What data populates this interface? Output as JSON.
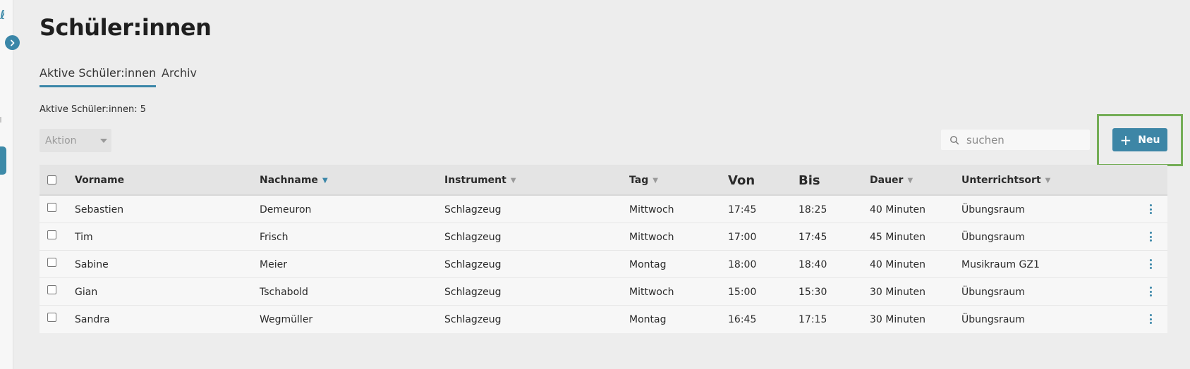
{
  "page": {
    "title": "Schüler:innen",
    "tabs": [
      {
        "label": "Aktive Schüler:innen",
        "active": true
      },
      {
        "label": "Archiv",
        "active": false
      }
    ],
    "count_label": "Aktive Schüler:innen: 5"
  },
  "toolbar": {
    "action_placeholder": "Aktion",
    "search_placeholder": "suchen",
    "new_button_label": "Neu",
    "new_button_icon": "plus-icon",
    "highlight_color": "#74ad56",
    "accent_color": "#3a86a8"
  },
  "table": {
    "columns": [
      {
        "label": "Vorname",
        "sort": "none"
      },
      {
        "label": "Nachname",
        "sort": "active-desc"
      },
      {
        "label": "Instrument",
        "sort": "sortable"
      },
      {
        "label": "Tag",
        "sort": "sortable"
      },
      {
        "label": "Von",
        "sort": "none"
      },
      {
        "label": "Bis",
        "sort": "none"
      },
      {
        "label": "Dauer",
        "sort": "sortable"
      },
      {
        "label": "Unterrichtsort",
        "sort": "sortable"
      }
    ],
    "rows": [
      {
        "vorname": "Sebastien",
        "nachname": "Demeuron",
        "instrument": "Schlagzeug",
        "tag": "Mittwoch",
        "von": "17:45",
        "bis": "18:25",
        "dauer": "40 Minuten",
        "ort": "Übungsraum"
      },
      {
        "vorname": "Tim",
        "nachname": "Frisch",
        "instrument": "Schlagzeug",
        "tag": "Mittwoch",
        "von": "17:00",
        "bis": "17:45",
        "dauer": "45 Minuten",
        "ort": "Übungsraum"
      },
      {
        "vorname": "Sabine",
        "nachname": "Meier",
        "instrument": "Schlagzeug",
        "tag": "Montag",
        "von": "18:00",
        "bis": "18:40",
        "dauer": "40 Minuten",
        "ort": "Musikraum GZ1"
      },
      {
        "vorname": "Gian",
        "nachname": "Tschabold",
        "instrument": "Schlagzeug",
        "tag": "Mittwoch",
        "von": "15:00",
        "bis": "15:30",
        "dauer": "30 Minuten",
        "ort": "Übungsraum"
      },
      {
        "vorname": "Sandra",
        "nachname": "Wegmüller",
        "instrument": "Schlagzeug",
        "tag": "Montag",
        "von": "16:45",
        "bis": "17:15",
        "dauer": "30 Minuten",
        "ort": "Übungsraum"
      }
    ]
  }
}
